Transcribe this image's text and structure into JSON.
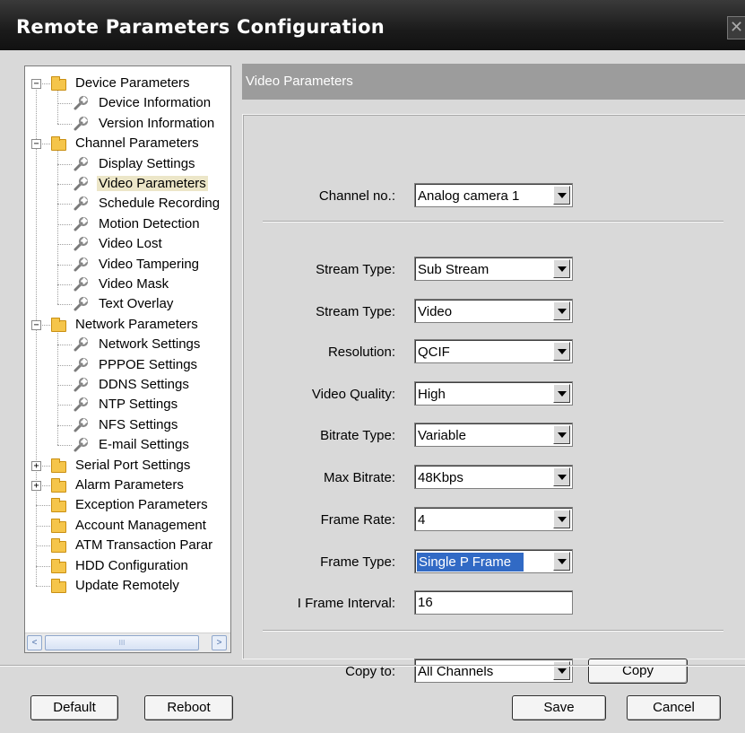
{
  "window": {
    "title": "Remote Parameters Configuration",
    "close_glyph": "✕"
  },
  "tree": {
    "nodes": [
      {
        "label": "Device Parameters",
        "type": "folder",
        "expander": "−"
      },
      {
        "label": "Device Information",
        "type": "leaf"
      },
      {
        "label": "Version Information",
        "type": "leaf"
      },
      {
        "label": "Channel Parameters",
        "type": "folder",
        "expander": "−"
      },
      {
        "label": "Display Settings",
        "type": "leaf"
      },
      {
        "label": "Video Parameters",
        "type": "leaf",
        "selected": true
      },
      {
        "label": "Schedule Recording",
        "type": "leaf"
      },
      {
        "label": "Motion Detection",
        "type": "leaf"
      },
      {
        "label": "Video Lost",
        "type": "leaf"
      },
      {
        "label": "Video Tampering",
        "type": "leaf"
      },
      {
        "label": "Video Mask",
        "type": "leaf"
      },
      {
        "label": "Text Overlay",
        "type": "leaf"
      },
      {
        "label": "Network Parameters",
        "type": "folder",
        "expander": "−"
      },
      {
        "label": "Network Settings",
        "type": "leaf"
      },
      {
        "label": "PPPOE Settings",
        "type": "leaf"
      },
      {
        "label": "DDNS Settings",
        "type": "leaf"
      },
      {
        "label": "NTP Settings",
        "type": "leaf"
      },
      {
        "label": "NFS Settings",
        "type": "leaf"
      },
      {
        "label": "E-mail Settings",
        "type": "leaf"
      },
      {
        "label": "Serial Port Settings",
        "type": "folder",
        "expander": "+"
      },
      {
        "label": "Alarm Parameters",
        "type": "folder",
        "expander": "+"
      },
      {
        "label": "Exception Parameters",
        "type": "folder"
      },
      {
        "label": "Account Management",
        "type": "folder"
      },
      {
        "label": "ATM Transaction Parar",
        "type": "folder"
      },
      {
        "label": "HDD Configuration",
        "type": "folder"
      },
      {
        "label": "Update Remotely",
        "type": "folder"
      }
    ],
    "scroll_left": "<",
    "scroll_right": ">",
    "scroll_grip": "III"
  },
  "section": {
    "title": "Video Parameters"
  },
  "form": {
    "channel": {
      "label": "Channel no.:",
      "value": "Analog camera 1"
    },
    "fields": [
      {
        "label": "Stream Type:",
        "value": "Sub Stream",
        "kind": "select"
      },
      {
        "label": "Stream Type:",
        "value": "Video",
        "kind": "select"
      },
      {
        "label": "Resolution:",
        "value": "QCIF",
        "kind": "select"
      },
      {
        "label": "Video Quality:",
        "value": "High",
        "kind": "select"
      },
      {
        "label": "Bitrate Type:",
        "value": "Variable",
        "kind": "select"
      },
      {
        "label": "Max Bitrate:",
        "value": "48Kbps",
        "kind": "select"
      },
      {
        "label": "Frame Rate:",
        "value": "4",
        "kind": "select"
      },
      {
        "label": "Frame Type:",
        "value": "Single P Frame",
        "kind": "select",
        "highlighted": true
      },
      {
        "label": "I Frame Interval:",
        "value": "16",
        "kind": "text"
      }
    ],
    "copy_to": {
      "label": "Copy to:",
      "value": "All Channels",
      "button": "Copy"
    }
  },
  "footer": {
    "default_label": "Default",
    "reboot_label": "Reboot",
    "save_label": "Save",
    "cancel_label": "Cancel"
  }
}
